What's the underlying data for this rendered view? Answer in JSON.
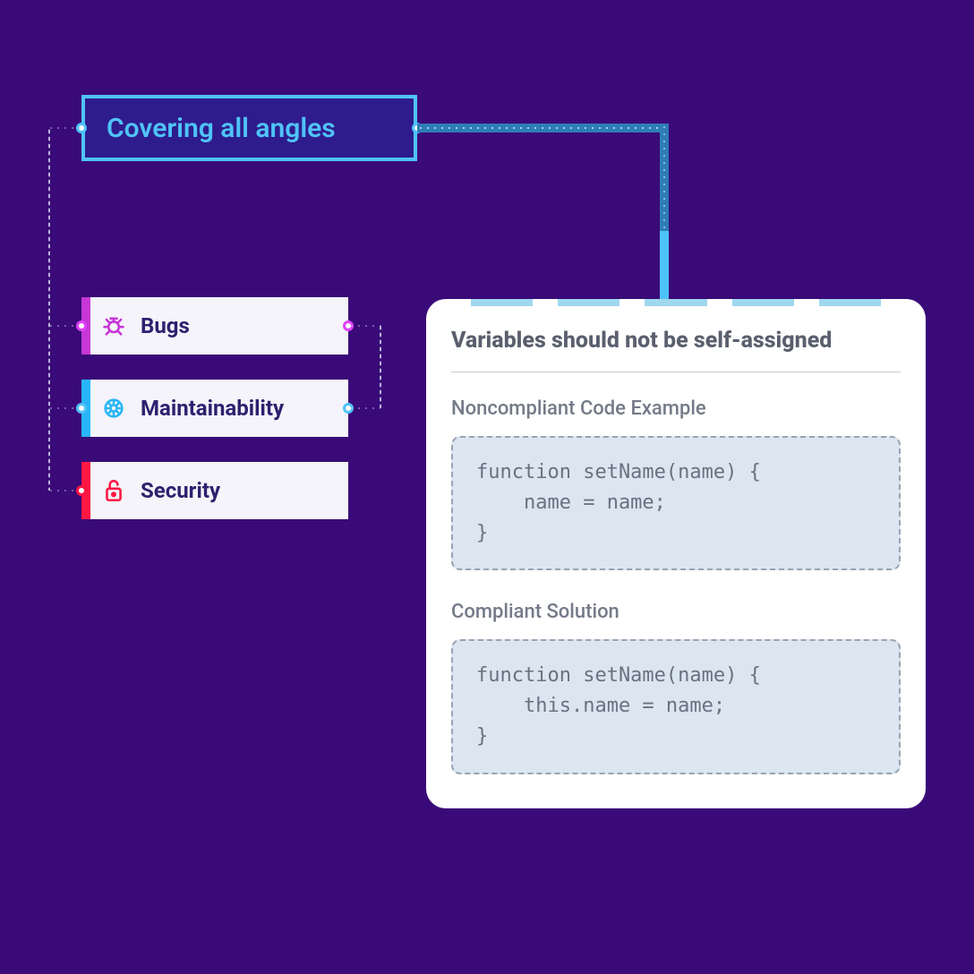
{
  "title": "Covering all angles",
  "categories": [
    {
      "label": "Bugs",
      "color": "#c736d6",
      "icon": "bug"
    },
    {
      "label": "Maintainability",
      "color": "#29b6f6",
      "icon": "gear"
    },
    {
      "label": "Security",
      "color": "#ff1744",
      "icon": "lock"
    }
  ],
  "panel": {
    "heading": "Variables should not be self-assigned",
    "noncompliant_title": "Noncompliant Code Example",
    "noncompliant_code": "function setName(name) {\n    name = name;\n}",
    "compliant_title": "Compliant Solution",
    "compliant_code": "function setName(name) {\n    this.name = name;\n}"
  }
}
